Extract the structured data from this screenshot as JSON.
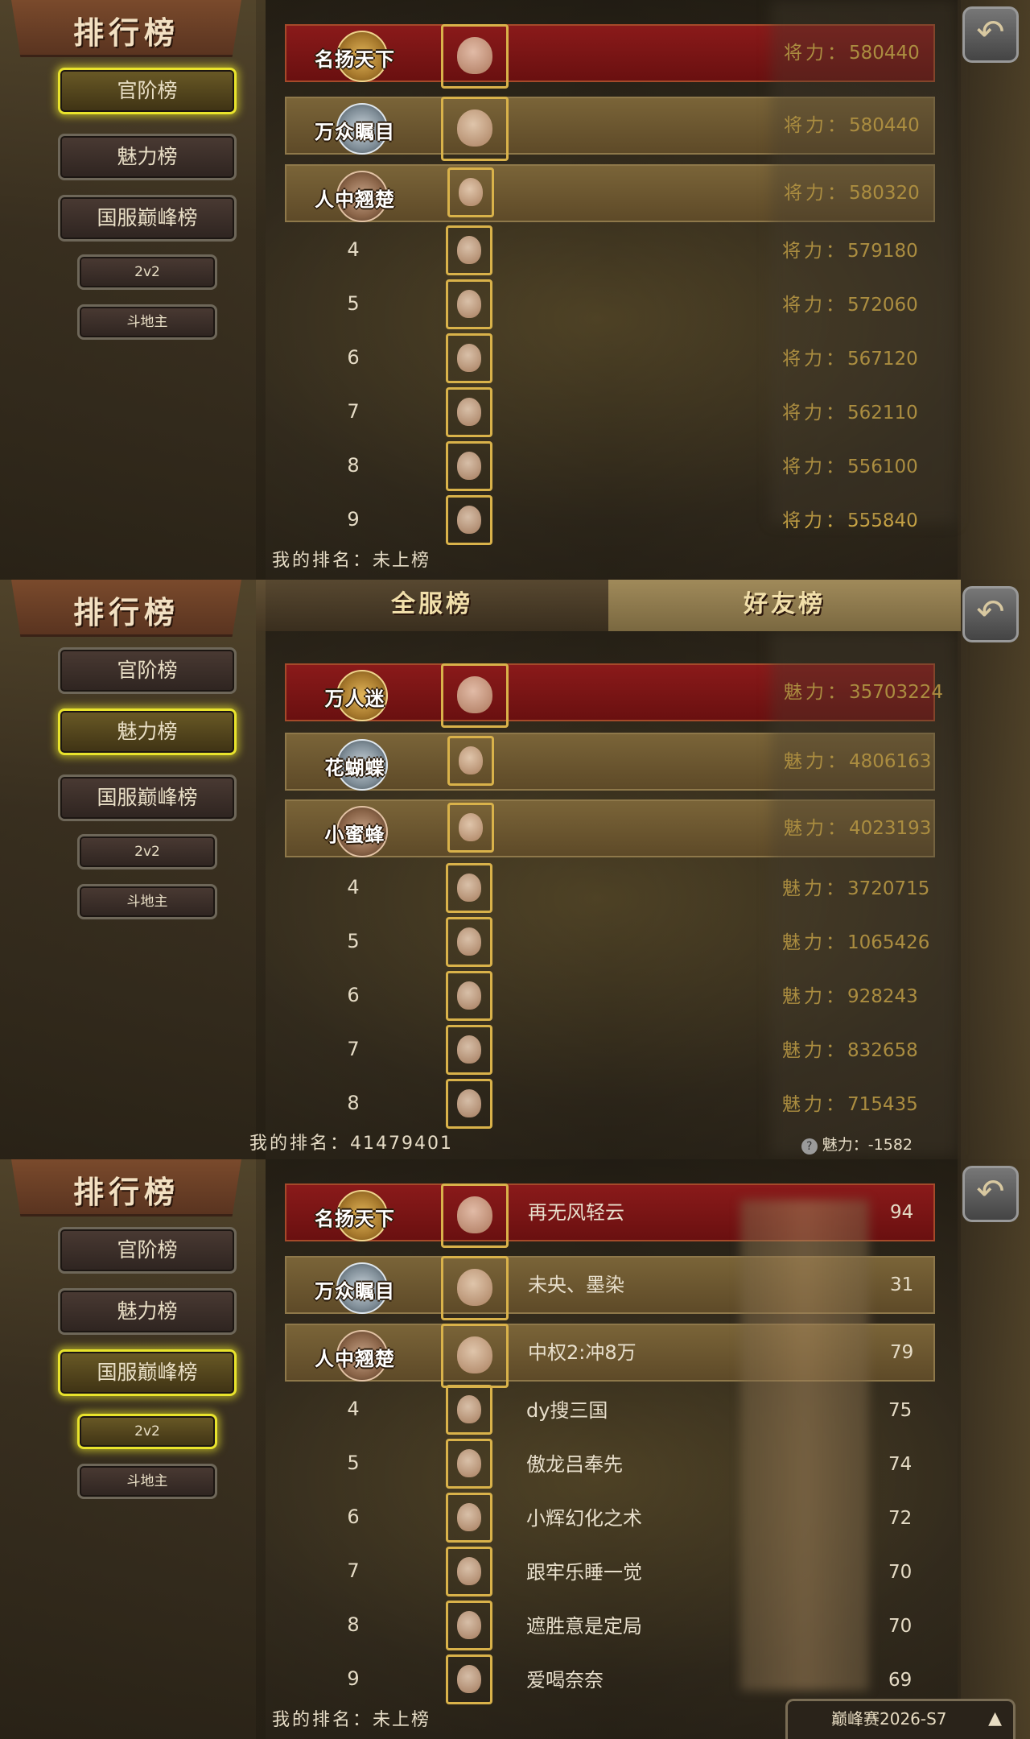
{
  "app": {
    "title": "排行榜",
    "back_icon": "back-arrow-icon"
  },
  "sidebar": {
    "buttons": [
      "官阶榜",
      "魅力榜",
      "国服巅峰榜"
    ],
    "small_buttons": [
      "2v2",
      "斗地主"
    ]
  },
  "panel1": {
    "active": "官阶榜",
    "stat_label": "将力：",
    "rows": [
      {
        "medal": "名扬天下",
        "value": "580440"
      },
      {
        "medal": "万众瞩目",
        "value": "580440"
      },
      {
        "medal": "人中翘楚",
        "value": "580320"
      },
      {
        "rank": "4",
        "value": "579180"
      },
      {
        "rank": "5",
        "value": "572060"
      },
      {
        "rank": "6",
        "value": "567120"
      },
      {
        "rank": "7",
        "value": "562110"
      },
      {
        "rank": "8",
        "value": "556100"
      },
      {
        "rank": "9",
        "value": "555840"
      }
    ],
    "my_rank_label": "我的排名：",
    "my_rank_value": "未上榜"
  },
  "panel2": {
    "active": "魅力榜",
    "tabs": [
      "全服榜",
      "好友榜"
    ],
    "stat_label": "魅力：",
    "rows": [
      {
        "medal": "万人迷",
        "value": "35703224"
      },
      {
        "medal": "花蝴蝶",
        "value": "4806163"
      },
      {
        "medal": "小蜜蜂",
        "value": "4023193"
      },
      {
        "rank": "4",
        "value": "3720715"
      },
      {
        "rank": "5",
        "value": "1065426"
      },
      {
        "rank": "6",
        "value": "928243"
      },
      {
        "rank": "7",
        "value": "832658"
      },
      {
        "rank": "8",
        "value": "715435"
      }
    ],
    "my_rank_label": "我的排名：",
    "my_rank_value": "41479401",
    "my_stat_label": "魅力：",
    "my_stat_value": "-1582"
  },
  "panel3": {
    "active": "国服巅峰榜",
    "active_small": "2v2",
    "rows": [
      {
        "medal": "名扬天下",
        "name": "再无风轻云",
        "value_partial": "94"
      },
      {
        "medal": "万众瞩目",
        "name": "未央、墨染",
        "value_partial": "31"
      },
      {
        "medal": "人中翘楚",
        "name": "中权2:冲8万",
        "value_partial": "79"
      },
      {
        "rank": "4",
        "name": "dy搜三国",
        "value_partial": "75"
      },
      {
        "rank": "5",
        "name": "傲龙吕奉先",
        "value_partial": "74"
      },
      {
        "rank": "6",
        "name": "小辉幻化之术",
        "value_partial": "72"
      },
      {
        "rank": "7",
        "name": "跟牢乐睡一觉",
        "value_partial": "70"
      },
      {
        "rank": "8",
        "name": "遮胜意是定局",
        "value_partial": "70"
      },
      {
        "rank": "9",
        "name": "爱喝奈奈",
        "value_partial": "69"
      }
    ],
    "my_rank_label": "我的排名：",
    "my_rank_value": "未上榜",
    "season_label": "巅峰赛2026-S7"
  }
}
